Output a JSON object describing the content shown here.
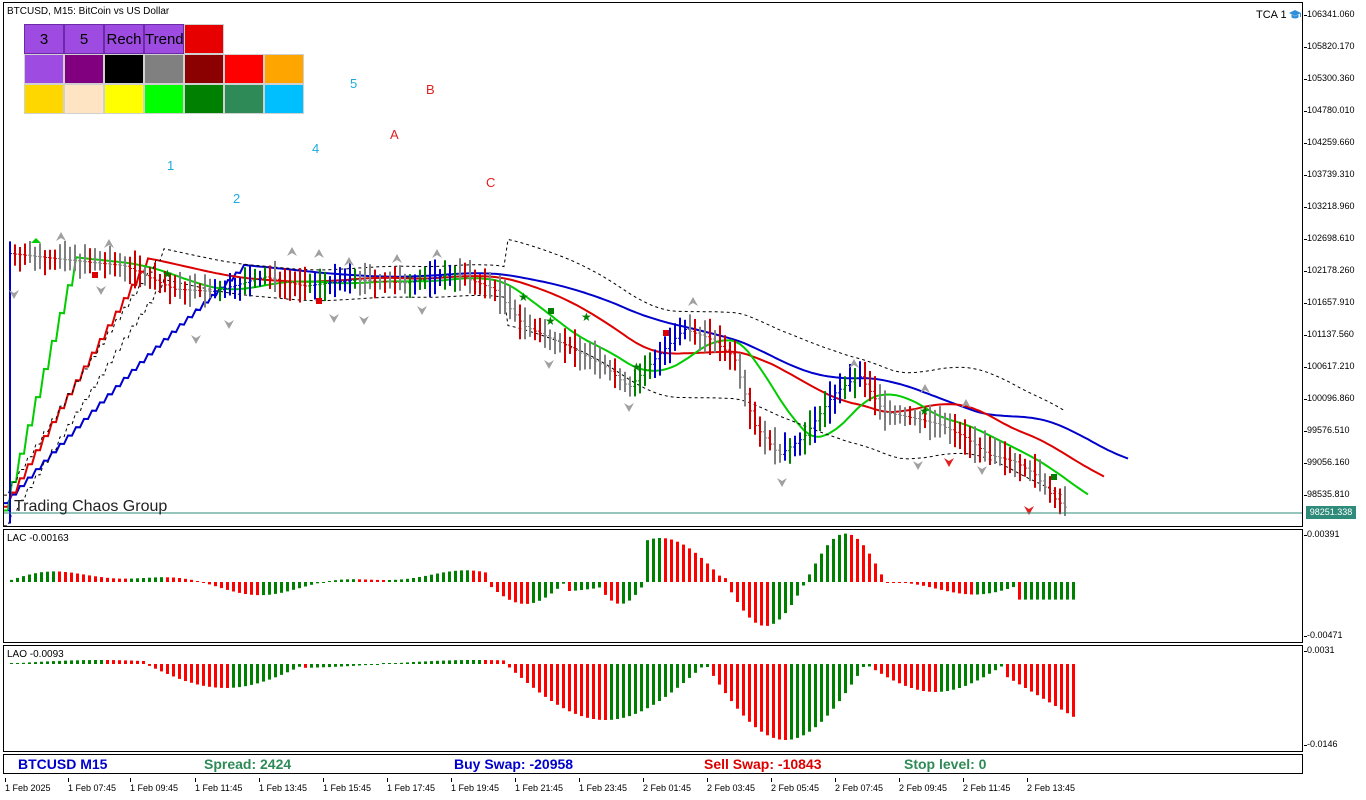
{
  "chart": {
    "title": "BTCUSD, M15:  BitCoin vs US Dollar",
    "watermark": "Trading Chaos Group",
    "tca_label": "TCA 1",
    "current_price": "98251.338",
    "price_scale": [
      "106341.060",
      "105820.170",
      "105300.360",
      "104780.010",
      "104259.660",
      "103739.310",
      "103218.960",
      "102698.610",
      "102178.260",
      "101657.910",
      "101137.560",
      "100617.210",
      "100096.860",
      "99576.510",
      "99056.160",
      "98535.810"
    ],
    "wave_labels": [
      {
        "text": "1",
        "color": "#1eaadf"
      },
      {
        "text": "2",
        "color": "#1eaadf"
      },
      {
        "text": "4",
        "color": "#1eaadf"
      },
      {
        "text": "5",
        "color": "#1eaadf"
      },
      {
        "text": "A",
        "color": "#e02020"
      },
      {
        "text": "B",
        "color": "#e02020"
      },
      {
        "text": "C",
        "color": "#e02020"
      }
    ]
  },
  "toolbar": {
    "buttons": [
      "3",
      "5",
      "Rech",
      "Trend"
    ],
    "swatch_colors": [
      "#e60000",
      "#9d4be0",
      "#800080",
      "#000000",
      "#808080",
      "#8b0000",
      "#ff0000",
      "#ffa500",
      "#ffd700",
      "#ffe4c4",
      "#ffff00",
      "#00ff00",
      "#008000",
      "#2e8b57",
      "#00bfff"
    ]
  },
  "lac": {
    "title": "LAC -0.00163",
    "scale": [
      "0.00391",
      "-0.00471"
    ],
    "colors": {
      "up": "#008000",
      "down": "#ff0000"
    }
  },
  "lao": {
    "title": "LAO -0.0093",
    "scale": [
      "0.0031",
      "-0.0146"
    ],
    "colors": {
      "up": "#008000",
      "down": "#ff0000"
    }
  },
  "status_bar": {
    "symbol": "BTCUSD M15",
    "spread": "Spread: 2424",
    "buy_swap": "Buy Swap: -20958",
    "sell_swap": "Sell Swap: -10843",
    "stop_level": "Stop level: 0"
  },
  "time_axis": [
    "1 Feb 2025",
    "1 Feb 07:45",
    "1 Feb 09:45",
    "1 Feb 11:45",
    "1 Feb 13:45",
    "1 Feb 15:45",
    "1 Feb 17:45",
    "1 Feb 19:45",
    "1 Feb 21:45",
    "1 Feb 23:45",
    "2 Feb 01:45",
    "2 Feb 03:45",
    "2 Feb 05:45",
    "2 Feb 07:45",
    "2 Feb 09:45",
    "2 Feb 11:45",
    "2 Feb 13:45"
  ],
  "colors": {
    "ma_blue": "#0000cc",
    "ma_red": "#dd0000",
    "ma_green": "#00cc00",
    "bar_green": "#008000",
    "bar_red": "#cc0000",
    "bar_blue": "#0000cc",
    "bar_gray": "#808080",
    "status_symbol": "#0000cc",
    "status_spread": "#2e8b57",
    "status_buy": "#0000cc",
    "status_sell": "#dd0000",
    "status_stop": "#2e8b57"
  }
}
